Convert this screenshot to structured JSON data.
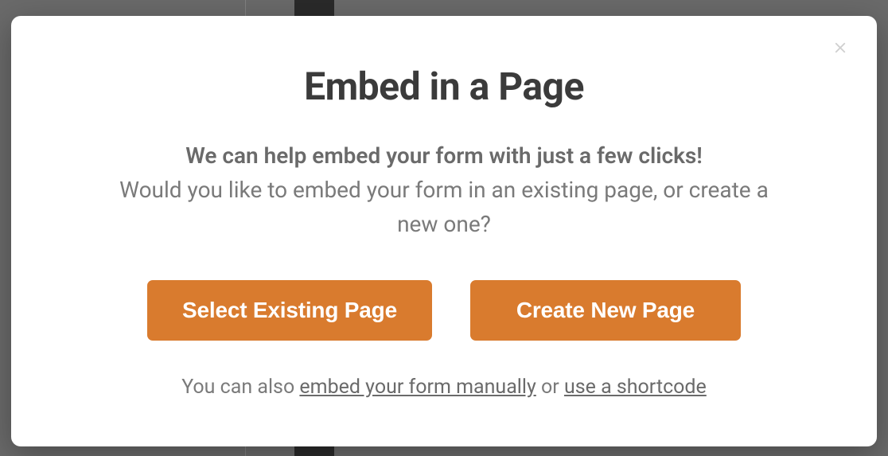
{
  "modal": {
    "title": "Embed in a Page",
    "subtitle_bold": "We can help embed your form with just a few clicks!",
    "subtitle": "Would you like to embed your form in an existing page, or create a new one?",
    "buttons": {
      "select_existing": "Select Existing Page",
      "create_new": "Create New Page"
    },
    "footer": {
      "prefix": "You can also ",
      "link_manual": "embed your form manually",
      "middle": " or ",
      "link_shortcode": "use a shortcode"
    }
  }
}
